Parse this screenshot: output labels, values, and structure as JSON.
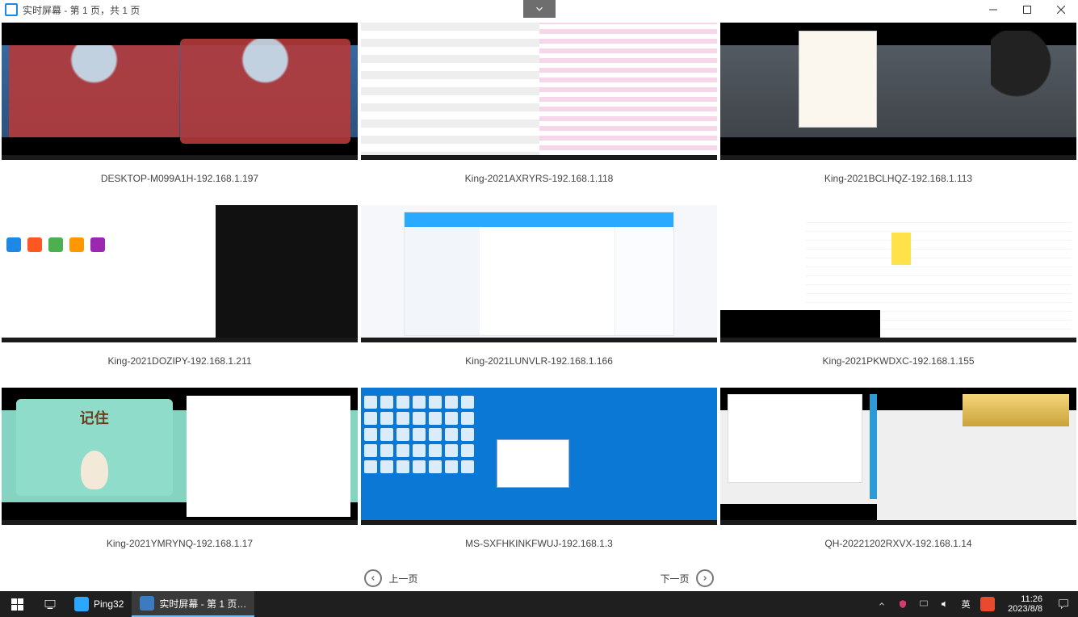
{
  "window": {
    "title": "实时屏幕 - 第 1 页，共 1 页"
  },
  "dropdown_glyph": "⌄",
  "screens": [
    {
      "name": "DESKTOP-M099A1H-192.168.1.197"
    },
    {
      "name": "King-2021AXRYRS-192.168.1.118"
    },
    {
      "name": "King-2021BCLHQZ-192.168.1.113"
    },
    {
      "name": "King-2021DOZIPY-192.168.1.211"
    },
    {
      "name": "King-2021LUNVLR-192.168.1.166"
    },
    {
      "name": "King-2021PKWDXC-192.168.1.155"
    },
    {
      "name": "King-2021YMRYNQ-192.168.1.17"
    },
    {
      "name": "MS-SXFHKINKFWUJ-192.168.1.3"
    },
    {
      "name": "QH-20221202RXVX-192.168.1.14"
    }
  ],
  "thumb7_card_text": "记住",
  "pager": {
    "prev": "上一页",
    "next": "下一页"
  },
  "taskbar": {
    "app1_label": "Ping32",
    "app2_label": "实时屏幕 - 第 1 页…",
    "ime": "英",
    "time": "11:26",
    "date": "2023/8/8"
  },
  "colors": {
    "accent": "#1e88e5",
    "taskbar_bg": "#1f1f1f",
    "ping32_icon": "#2aa8ff",
    "sogou_icon": "#e74a2d"
  }
}
